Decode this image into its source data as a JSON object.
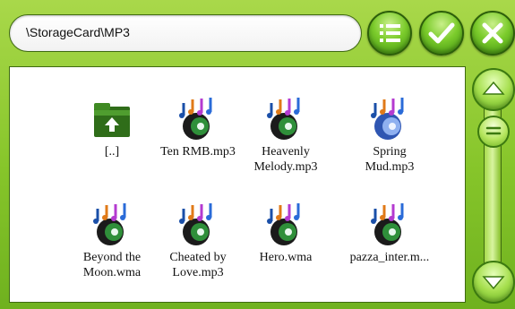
{
  "path_bar": {
    "text": "\\StorageCard\\MP3"
  },
  "toolbar": {
    "menu_icon": "list-menu-icon",
    "ok_icon": "checkmark-icon",
    "close_icon": "close-icon"
  },
  "files": [
    {
      "label": "[..]",
      "icon": "folder-up-icon"
    },
    {
      "label": "Ten RMB.mp3",
      "icon": "music-file-icon"
    },
    {
      "label": "Heavenly\nMelody.mp3",
      "icon": "music-file-icon"
    },
    {
      "label": "Spring\nMud.mp3",
      "icon": "music-file-icon"
    },
    {
      "label": "Beyond the\nMoon.wma",
      "icon": "music-file-icon"
    },
    {
      "label": "Cheated by\nLove.mp3",
      "icon": "music-file-icon"
    },
    {
      "label": "Hero.wma",
      "icon": "music-file-icon"
    },
    {
      "label": "pazza_inter.m...",
      "icon": "music-file-icon"
    }
  ],
  "scrollbar": {
    "up_icon": "scroll-up-icon",
    "down_icon": "scroll-down-icon",
    "thumb_icon": "scroll-thumb-grip-icon"
  },
  "colors": {
    "frame": "#86c52a",
    "dark_border": "#3e6a10"
  }
}
